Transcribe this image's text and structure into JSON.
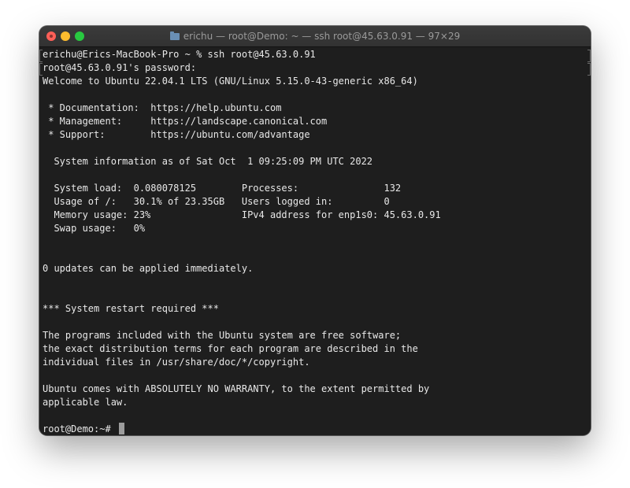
{
  "window": {
    "title": "erichu — root@Demo: ~ — ssh root@45.63.0.91 — 97×29"
  },
  "terminal": {
    "lines": [
      "erichu@Erics-MacBook-Pro ~ % ssh root@45.63.0.91",
      "root@45.63.0.91's password:",
      "Welcome to Ubuntu 22.04.1 LTS (GNU/Linux 5.15.0-43-generic x86_64)",
      "",
      " * Documentation:  https://help.ubuntu.com",
      " * Management:     https://landscape.canonical.com",
      " * Support:        https://ubuntu.com/advantage",
      "",
      "  System information as of Sat Oct  1 09:25:09 PM UTC 2022",
      "",
      "  System load:  0.080078125        Processes:               132",
      "  Usage of /:   30.1% of 23.35GB   Users logged in:         0",
      "  Memory usage: 23%                IPv4 address for enp1s0: 45.63.0.91",
      "  Swap usage:   0%",
      "",
      "",
      "0 updates can be applied immediately.",
      "",
      "",
      "*** System restart required ***",
      "",
      "The programs included with the Ubuntu system are free software;",
      "the exact distribution terms for each program are described in the",
      "individual files in /usr/share/doc/*/copyright.",
      "",
      "Ubuntu comes with ABSOLUTELY NO WARRANTY, to the extent permitted by",
      "applicable law.",
      ""
    ],
    "prompt": "root@Demo:~# "
  }
}
